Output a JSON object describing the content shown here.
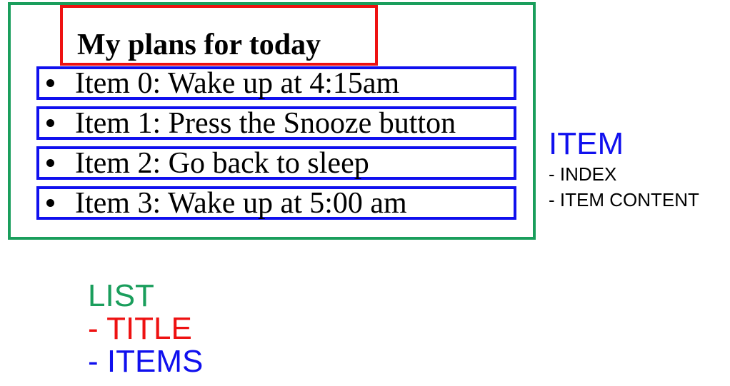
{
  "list": {
    "title": "My plans for today",
    "items": [
      "Item 0: Wake up at 4:15am",
      "Item 1: Press the Snooze button",
      "Item 2: Go back to sleep",
      "Item 3: Wake up at 5:00 am"
    ]
  },
  "legend_item": {
    "heading": "ITEM",
    "lines": [
      "- INDEX",
      "- ITEM CONTENT"
    ]
  },
  "legend_list": {
    "heading": "LIST",
    "lines": [
      "- TITLE",
      "- ITEMS"
    ]
  },
  "colors": {
    "list": "#1a9e5c",
    "title": "#ee1111",
    "item": "#1010ee",
    "text": "#000000"
  }
}
